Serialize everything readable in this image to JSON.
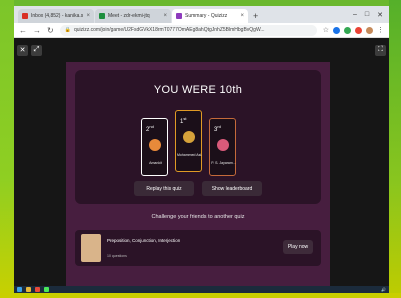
{
  "browser": {
    "tabs": [
      {
        "label": "Inbox (4,852) - kanika.s@aisect.or",
        "color": "#d93025"
      },
      {
        "label": "Meet - zdr-ekmi-jtq",
        "color": "#1e8e3e"
      },
      {
        "label": "Summary - Quizizz",
        "color": "#8e3bbd"
      }
    ],
    "new_tab": "+",
    "url": "quizizz.com/join/game/U2FsdGVkX18rmT0777OmAEg8ahQtgJnhZ5BlmHbgBvQgW...",
    "nav": {
      "back": "←",
      "forward": "→",
      "reload": "↻"
    }
  },
  "app": {
    "close_label": "✕",
    "collapse_label": "⤢",
    "fullscreen_label": "⛶"
  },
  "result": {
    "title": "YOU WERE 10th",
    "podium": [
      {
        "rank": "2",
        "suffix": "nd",
        "name": "Amankit",
        "avatar_color": "#e88a3a"
      },
      {
        "rank": "1",
        "suffix": "st",
        "name": "Mohammed Asi...",
        "avatar_color": "#d6a23a"
      },
      {
        "rank": "3",
        "suffix": "rd",
        "name": "P. S. Jayaram...",
        "avatar_color": "#d95a7a"
      }
    ],
    "replay_label": "Replay this quiz",
    "leaderboard_label": "Show leaderboard"
  },
  "challenge": {
    "text": "Challenge your friends to another quiz",
    "quiz_title": "Preposition, Conjunction, Interjection",
    "quiz_count": "10 questions",
    "play_label": "Play now"
  }
}
